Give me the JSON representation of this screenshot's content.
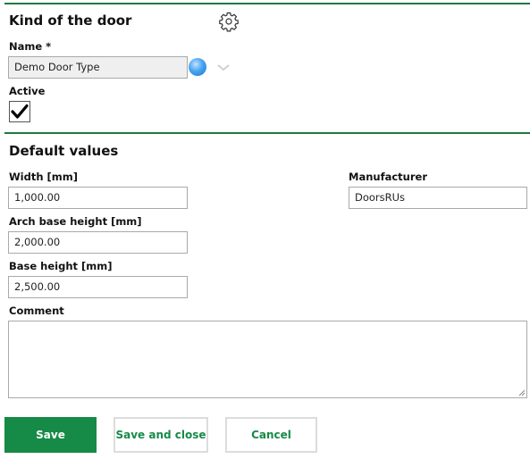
{
  "header": {
    "title": "Kind of the door",
    "settings_icon": "gear-icon"
  },
  "name_field": {
    "label": "Name *",
    "value": "Demo Door Type",
    "translate_icon": "globe-icon",
    "expand_icon": "chevron-down-icon"
  },
  "active_field": {
    "label": "Active",
    "checked": true,
    "check_glyph": "✔"
  },
  "defaults": {
    "title": "Default values",
    "width": {
      "label": "Width [mm]",
      "value": "1,000.00"
    },
    "arch_base_height": {
      "label": "Arch base height [mm]",
      "value": "2,000.00"
    },
    "base_height": {
      "label": "Base height [mm]",
      "value": "2,500.00"
    },
    "manufacturer": {
      "label": "Manufacturer",
      "value": "DoorsRUs"
    },
    "comment": {
      "label": "Comment",
      "value": ""
    }
  },
  "actions": {
    "save": "Save",
    "save_and_close": "Save and close",
    "cancel": "Cancel"
  },
  "colors": {
    "accent": "#168a47",
    "divider": "#1a7a3e"
  }
}
